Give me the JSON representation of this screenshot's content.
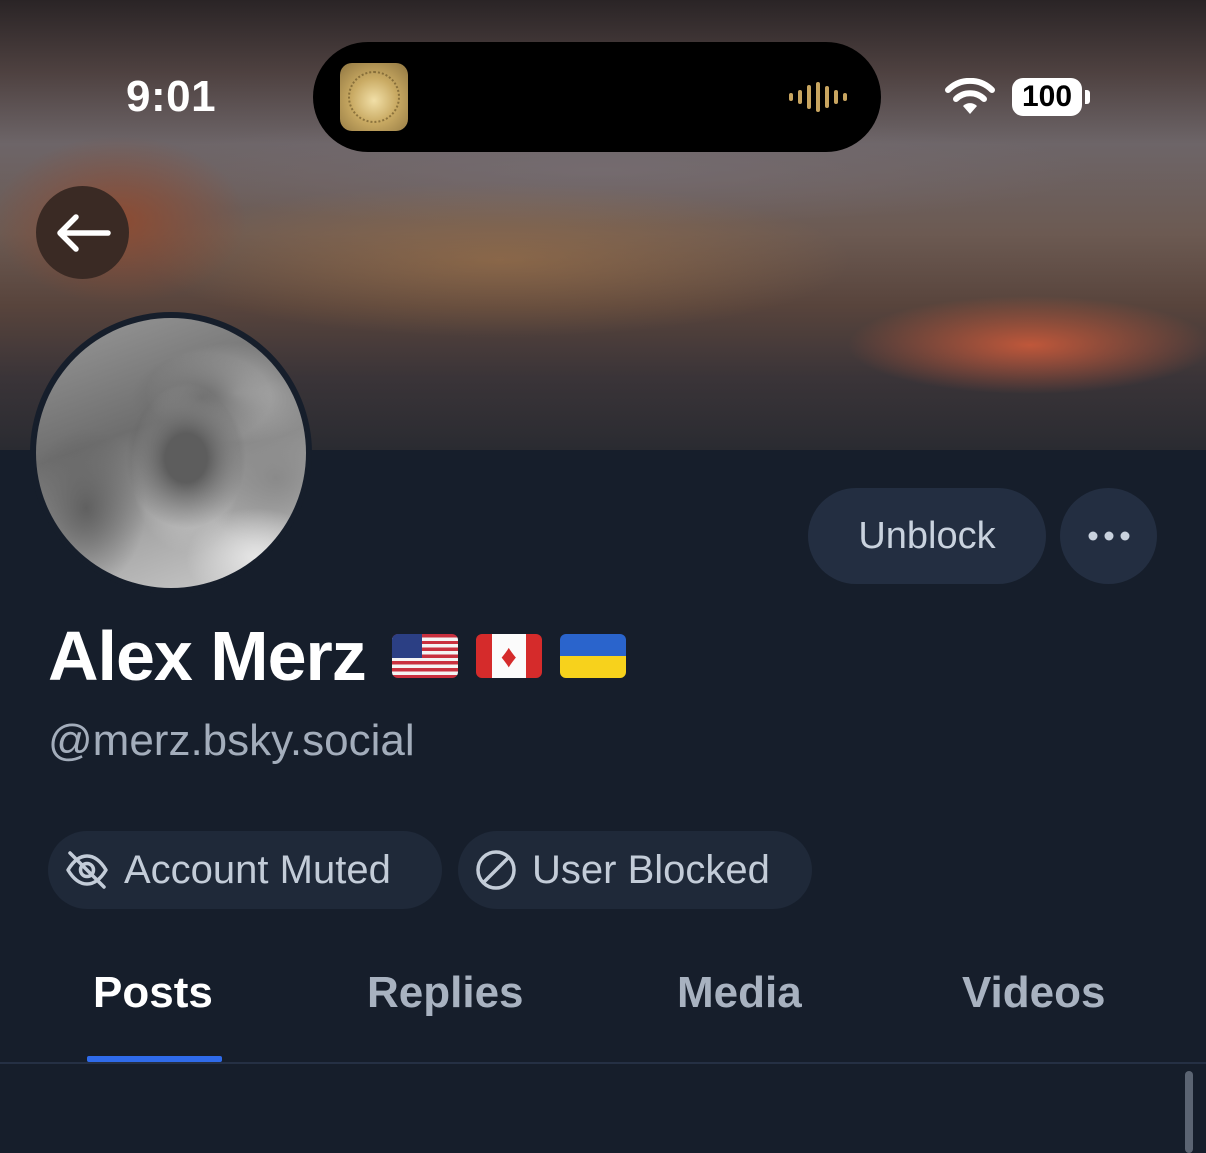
{
  "status_bar": {
    "time": "9:01",
    "battery": "100",
    "icons": [
      "album-art-icon",
      "waveform-icon",
      "wifi-icon",
      "battery-icon"
    ]
  },
  "header": {
    "back_icon": "arrow-left-icon"
  },
  "profile": {
    "display_name": "Alex Merz",
    "flags": [
      "us-flag",
      "canada-flag",
      "ukraine-flag"
    ],
    "handle": "@merz.bsky.social",
    "unblock_label": "Unblock",
    "more_icon": "ellipsis-icon"
  },
  "badges": [
    {
      "label": "Account Muted",
      "icon": "eye-slash-icon"
    },
    {
      "label": "User Blocked",
      "icon": "block-icon"
    }
  ],
  "tabs": [
    {
      "label": "Posts",
      "active": true
    },
    {
      "label": "Replies",
      "active": false
    },
    {
      "label": "Media",
      "active": false
    },
    {
      "label": "Videos",
      "active": false
    }
  ],
  "colors": {
    "background": "#161e2b",
    "button_bg": "#232e41",
    "accent": "#2f6bea",
    "muted_text": "#a3adbb"
  }
}
